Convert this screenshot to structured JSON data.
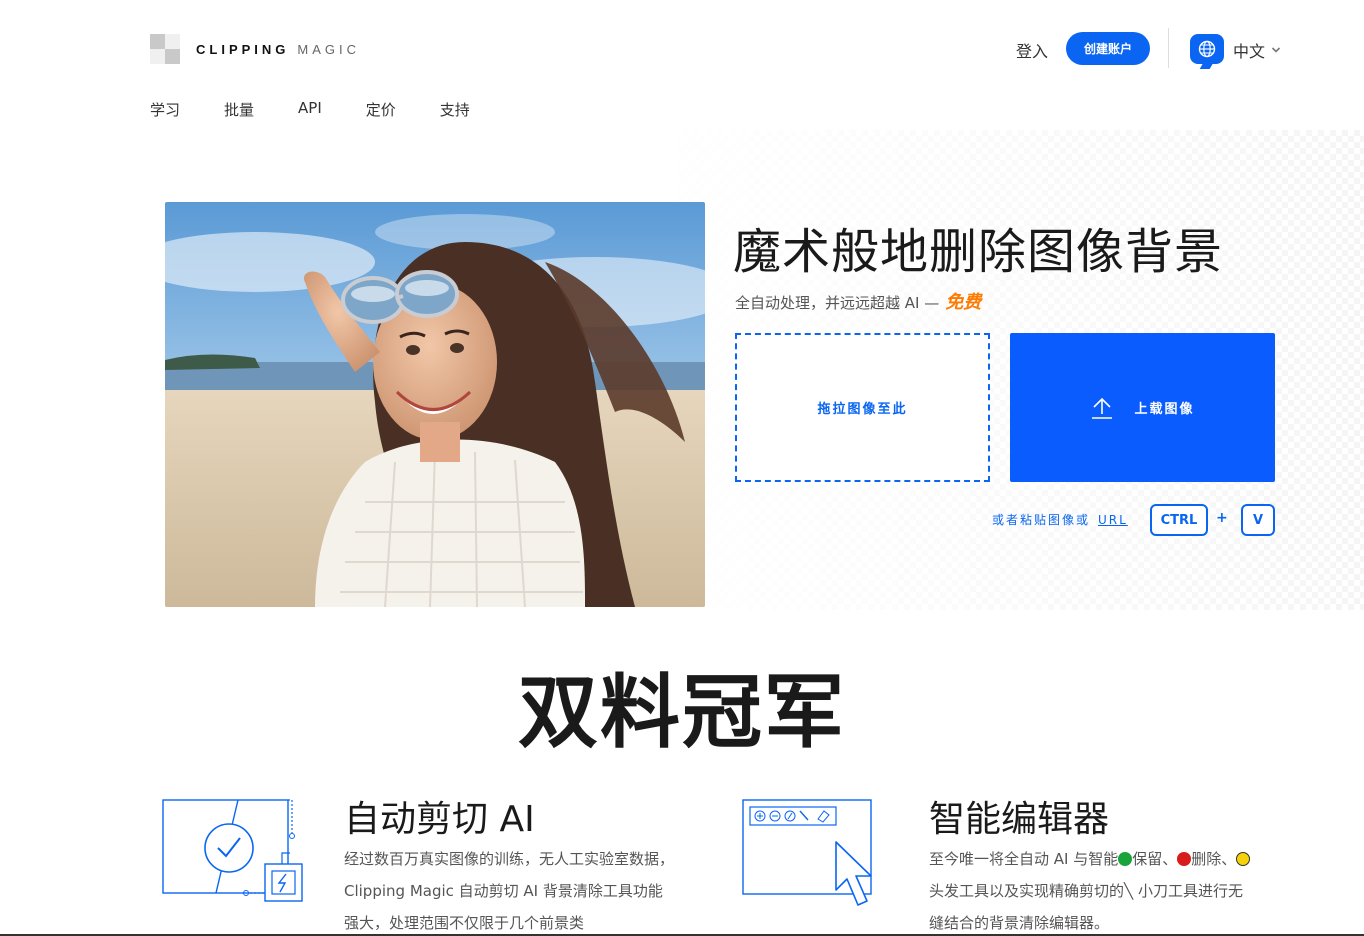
{
  "header": {
    "logo_word1": "CLIPPING",
    "logo_word2": "MAGIC",
    "login_label": "登入",
    "signup_label": "创建账户",
    "language_label": "中文",
    "language_icon": "globe-icon"
  },
  "nav": {
    "items": [
      "学习",
      "批量",
      "API",
      "定价",
      "支持"
    ]
  },
  "hero": {
    "title": "魔术般地删除图像背景",
    "subtitle": "全自动处理，并远远超越 AI —",
    "subtitle_highlight": "免费",
    "dropzone_label": "拖拉图像至此",
    "upload_label": "上载图像",
    "paste_text": "或者粘贴图像或",
    "paste_link": "URL",
    "key_ctrl": "CTRL",
    "key_plus": "+",
    "key_v": "V"
  },
  "section": {
    "title": "双料冠军"
  },
  "features": {
    "ai": {
      "title": "自动剪切 AI",
      "text": "经过数百万真实图像的训练，无人工实验室数据，Clipping Magic 自动剪切 AI 背景清除工具功能强大，处理范围不仅限于几个前景类"
    },
    "editor": {
      "title": "智能编辑器",
      "text_1": "至今唯一将全自动 AI 与智能",
      "text_2": "保留、",
      "text_3": "删除、",
      "text_4": "头发工具以及实现精确剪切的",
      "text_5": "小刀工具进行无缝结合的背景清除编辑器。"
    }
  },
  "colors": {
    "brand_blue": "#0a66f2",
    "highlight_orange": "#ff7a00"
  }
}
